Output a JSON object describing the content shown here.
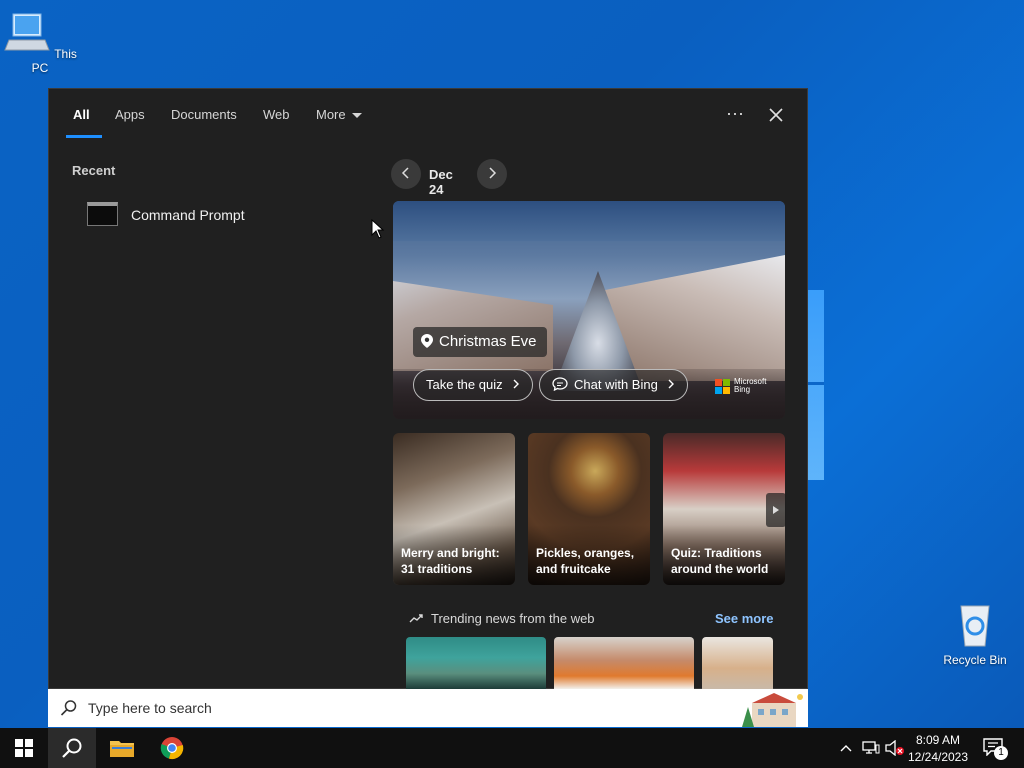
{
  "desktop": {
    "icons": [
      {
        "label": "This PC"
      },
      {
        "label": "Recycle Bin"
      }
    ]
  },
  "search_panel": {
    "tabs": [
      {
        "label": "All",
        "active": true
      },
      {
        "label": "Apps"
      },
      {
        "label": "Documents"
      },
      {
        "label": "Web"
      },
      {
        "label": "More"
      }
    ],
    "options_icon": "ellipsis-icon",
    "close_icon": "close-icon",
    "recent": {
      "heading": "Recent",
      "items": [
        {
          "label": "Command Prompt",
          "icon": "command-prompt-icon"
        }
      ]
    },
    "highlight": {
      "date": "Dec 24",
      "title": "Christmas Eve",
      "quiz_label": "Take the quiz",
      "chat_label": "Chat with Bing",
      "brand_line1": "Microsoft",
      "brand_line2": "Bing"
    },
    "cards": [
      {
        "caption": "Merry and bright: 31 traditions"
      },
      {
        "caption": "Pickles, oranges, and fruitcake"
      },
      {
        "caption": "Quiz: Traditions around the world"
      }
    ],
    "trending": {
      "heading": "Trending news from the web",
      "see_more": "See more"
    }
  },
  "searchbox": {
    "placeholder": "Type here to search"
  },
  "taskbar": {
    "clock_time": "8:09 AM",
    "clock_date": "12/24/2023",
    "notification_count": "1"
  },
  "colors": {
    "accent": "#1e8fff",
    "panel_bg": "#202020",
    "link": "#8ec4ff"
  }
}
